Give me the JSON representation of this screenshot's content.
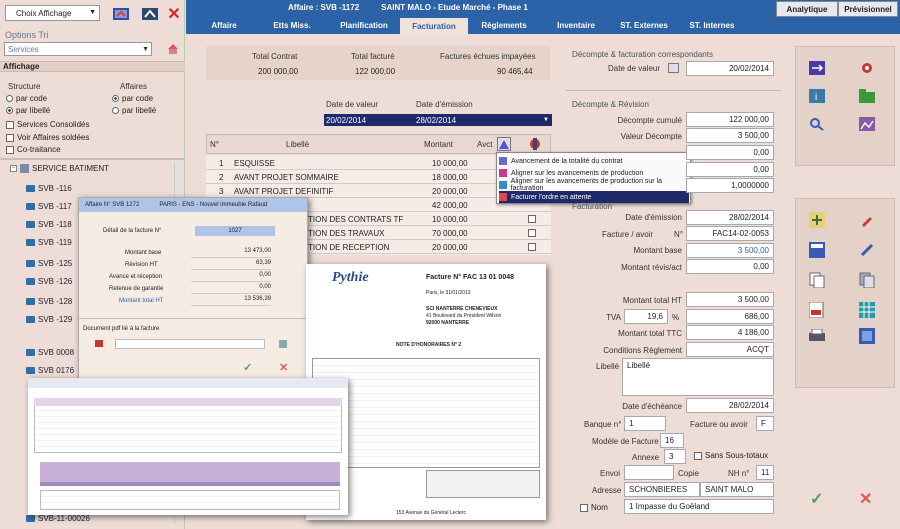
{
  "top": {
    "choix_label": "Choix Affichage",
    "title_code": "Affaire : SVB -1172",
    "title_place": "SAINT MALO - Etude Marché - Phase 1",
    "analytique": "Analytique",
    "previsionnel": "Prévisionnel"
  },
  "tabs": [
    "Affaire",
    "Etts Miss.",
    "Planification",
    "Facturation",
    "Règlements",
    "Inventaire",
    "ST. Externes",
    "ST. Internes"
  ],
  "left": {
    "options_title": "Options Tri",
    "services_value": "Services",
    "affichage_title": "Affichage",
    "structure_label": "Structure",
    "affaires_label": "Affaires",
    "par_code": "par code",
    "par_libelle": "par libellé",
    "aff_par_code": "par code",
    "aff_par_libelle": "par libellé",
    "services_consolides": "Services Consolidés",
    "voir_affaires_soldees": "Voir Affaires soldées",
    "co_traitance": "Co-traitance",
    "tree_root": "SERVICE BATIMENT",
    "tree_items": [
      "SVB -116",
      "SVB -117",
      "SVB -118",
      "SVB -119",
      "SVB -125",
      "SVB -126",
      "SVB -128",
      "SVB -129",
      "SVB 0008",
      "SVB 0176"
    ],
    "tree_last": "SVB-11-00026"
  },
  "summary": {
    "total_contrat_label": "Total Contrat",
    "total_facture_label": "Total facturé",
    "echues_label": "Factures échues impayées",
    "total_contrat": "200 000,00",
    "total_facture": "122 000,00",
    "echues": "90 465,44"
  },
  "dates": {
    "valeur_label": "Date de valeur",
    "emission_label": "Date d'émission",
    "valeur": "20/02/2014",
    "emission": "28/02/2014"
  },
  "grid": {
    "col_n": "N°",
    "col_libelle": "Libellé",
    "col_montant": "Montant",
    "col_avct": "Avct",
    "rows": [
      {
        "n": "1",
        "libelle": "ESQUISSE",
        "montant": "10 000,00"
      },
      {
        "n": "2",
        "libelle": "AVANT PROJET SOMMAIRE",
        "montant": "18 000,00"
      },
      {
        "n": "3",
        "libelle": "AVANT PROJET DEFINITIF",
        "montant": "20 000,00"
      },
      {
        "n": "",
        "libelle": "",
        "montant": "42 000,00"
      },
      {
        "n": "",
        "libelle": "TION DES CONTRATS TF",
        "montant": "10 000,00"
      },
      {
        "n": "",
        "libelle": "TION DES TRAVAUX",
        "montant": "70 000,00"
      },
      {
        "n": "",
        "libelle": "TION DE RECEPTION",
        "montant": "20 000,00"
      }
    ]
  },
  "context_menu": [
    "Avancement de la totalité du contrat",
    "Aligner sur les avancements de production",
    "Aligner sur les avancements de production sur la facturation",
    "Facturer l'ordre en attente"
  ],
  "right": {
    "decompte_title": "Décompte & facturation correspondants",
    "date_valeur_label": "Date de valeur",
    "date_valeur": "20/02/2014",
    "revision_title": "Décompte & Révision",
    "decompte_cumule_label": "Décompte cumulé",
    "decompte_cumule": "122 000,00",
    "valeur_decompte_label": "Valeur Décompte",
    "valeur_decompte": "3 500,00",
    "blank1": "0,00",
    "blank2": "0,00",
    "blank3": "1,0000000",
    "facturation_title": "Facturation",
    "date_emission_label": "Date d'émission",
    "date_emission": "28/02/2014",
    "facture_avoir_label": "Facture  /  avoir",
    "facture_n_label": "N°",
    "facture_n": "FAC14-02-0053",
    "montant_base_label": "Montant base",
    "montant_base": "3 500,00",
    "montant_revis_label": "Montant révis/act",
    "montant_revis": "0,00",
    "montant_ht_label": "Montant total HT",
    "montant_ht": "3 500,00",
    "tva_label": "TVA",
    "tva_rate": "19,6",
    "tva_pct": "%",
    "tva_value": "686,00",
    "montant_ttc_label": "Montant total TTC",
    "montant_ttc": "4 186,00",
    "conditions_label": "Conditions Règlement",
    "conditions": "ACQT",
    "libelle_label": "Libellé",
    "libelle": "Libellé",
    "echeance_label": "Date d'échéance",
    "echeance": "28/02/2014",
    "banque_label": "Banque n°",
    "banque": "1",
    "fac_avoir_label": "Facture ou avoir",
    "fac_avoir": "F",
    "modele_label": "Modèle de Facture",
    "modele": "16",
    "annexe_label": "Annexe",
    "annexe": "3",
    "sans_sous_totaux": "Sans Sous-totaux",
    "envoi_label": "Envoi",
    "copie_label": "Copie",
    "nh_label": "NH n°",
    "nh": "11",
    "adresse_label": "Adresse",
    "adresse1": "SCHONBIERES",
    "adresse2": "SAINT MALO",
    "nom_label": "Nom",
    "nom": "1 Impasse du Goëland"
  },
  "popup": {
    "header_left": "Affaire N° SVB 1272",
    "header_right": "PARIS - ENS - Nouvel immeuble Rafaud",
    "detail_label": "Détail de la facture N°",
    "detail_value": "1027",
    "rows": [
      {
        "label": "Montant base",
        "value": "13 473,00"
      },
      {
        "label": "Révision HT",
        "value": "63,39"
      },
      {
        "label": "Avance et réception",
        "value": "0,00"
      },
      {
        "label": "Retenue de garantie",
        "value": "0,00"
      },
      {
        "label": "Montant total HT",
        "value": "13 536,39"
      }
    ],
    "doc_label": "Document pdf lié à la facture"
  },
  "invoice": {
    "logo": "Pythie",
    "title": "Facture N° FAC 13 01 0048",
    "city_date": "Paris, le 31/01/2013",
    "client": "SCI NANTERRE CHENEVIEUX",
    "street": "41 Boulevard du Président Wilson",
    "zip_city": "92000 NANTERRE",
    "note": "NOTE D'HONORAIRES N° 2",
    "footer": "153 Avenue du Général Leclerc"
  }
}
